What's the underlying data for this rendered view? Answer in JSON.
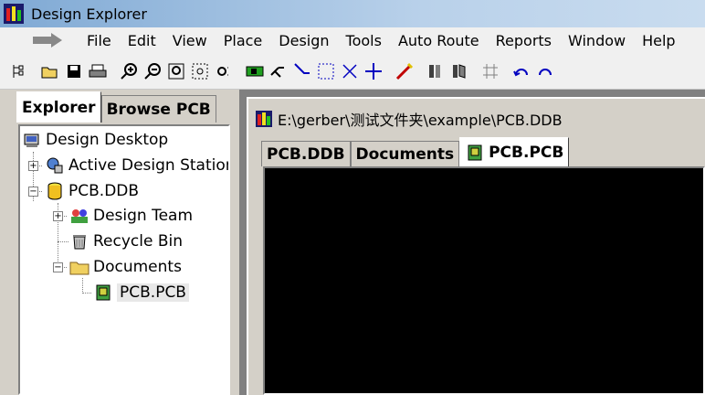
{
  "window": {
    "title": "Design Explorer"
  },
  "menu": {
    "items": [
      "File",
      "Edit",
      "View",
      "Place",
      "Design",
      "Tools",
      "Auto Route",
      "Reports",
      "Window",
      "Help"
    ]
  },
  "explorer": {
    "tabs": [
      "Explorer",
      "Browse PCB"
    ],
    "tree": {
      "root": "Design Desktop",
      "station": "Active Design Stations",
      "ddb": "PCB.DDB",
      "team": "Design Team",
      "recycle": "Recycle Bin",
      "documents": "Documents",
      "pcb": "PCB.PCB"
    }
  },
  "document": {
    "path": "E:\\gerber\\测试文件夹\\example\\PCB.DDB",
    "tabs": [
      "PCB.DDB",
      "Documents",
      "PCB.PCB"
    ]
  },
  "colors": {
    "canvas": "#000000",
    "titlebar": "#b9d1ea"
  }
}
